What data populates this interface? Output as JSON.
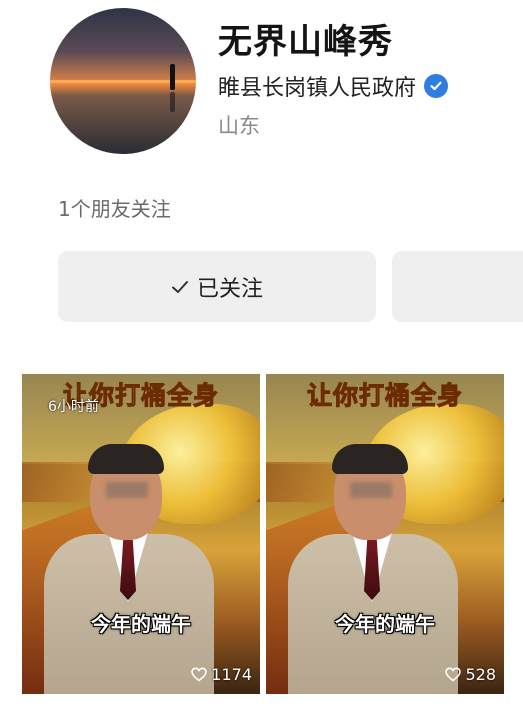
{
  "profile": {
    "name": "无界山峰秀",
    "organization": "睢县长岗镇人民政府",
    "region": "山东",
    "friends_following": "1个朋友关注"
  },
  "actions": {
    "follow_label": "已关注",
    "check_icon": "check-icon"
  },
  "videos": [
    {
      "top_text": "让你打桶全身",
      "time_ago": "6小时前",
      "caption": "今年的端午",
      "likes": "1174"
    },
    {
      "top_text": "让你打桶全身",
      "caption": "今年的端午",
      "likes": "528"
    }
  ],
  "colors": {
    "verified_badge": "#2f7de1",
    "button_bg": "#efefef"
  }
}
